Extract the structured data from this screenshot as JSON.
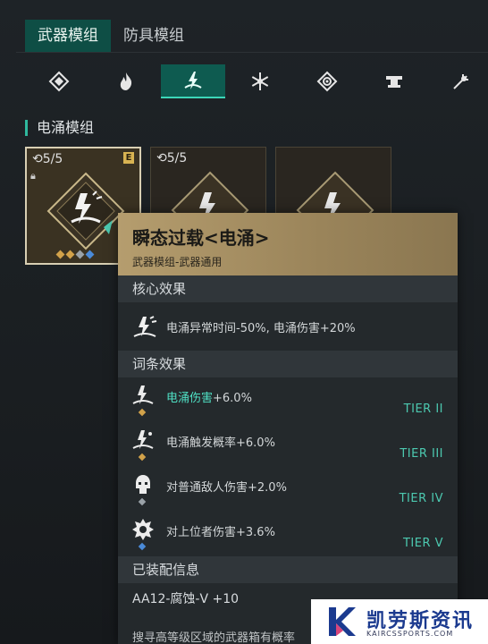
{
  "tabs": [
    {
      "label": "武器模组",
      "active": true
    },
    {
      "label": "防具模组",
      "active": false
    }
  ],
  "categories": [
    {
      "icon": "diamond-icon"
    },
    {
      "icon": "flame-icon"
    },
    {
      "icon": "electric-icon",
      "active": true
    },
    {
      "icon": "snowflake-icon"
    },
    {
      "icon": "poison-icon"
    },
    {
      "icon": "anvil-icon"
    },
    {
      "icon": "burst-icon"
    }
  ],
  "section_title": "电涌模组",
  "cards": [
    {
      "count": "5/5",
      "rank": "E",
      "selected": true
    },
    {
      "count": "5/5",
      "selected": false
    },
    {
      "selected": false
    }
  ],
  "tooltip": {
    "title": "瞬态过载<电涌>",
    "subtitle": "武器模组-武器通用",
    "core_label": "核心效果",
    "core_text": "电涌异常时间-50%, 电涌伤害+20%",
    "entries_label": "词条效果",
    "entries": [
      {
        "highlight": "电涌伤害",
        "rest": "+6.0%",
        "tier": "TIER II",
        "color": "#d2a24a"
      },
      {
        "highlight": "",
        "rest": "电涌触发概率+6.0%",
        "tier": "TIER III",
        "color": "#d2a24a"
      },
      {
        "highlight": "",
        "rest": "对普通敌人伤害+2.0%",
        "tier": "TIER IV",
        "color": "#9aa2a8"
      },
      {
        "highlight": "",
        "rest": "对上位者伤害+3.6%",
        "tier": "TIER V",
        "color": "#4a8ad8"
      }
    ],
    "equipped_label": "已装配信息",
    "weapon": "AA12-腐蚀-V +10",
    "bottom_text": "搜寻高等级区域的武器箱有概率"
  },
  "watermark": {
    "name": "凯劳斯资讯",
    "url": "KAIRCSSPORTS.COM"
  },
  "colors": {
    "accent": "#2fb89d",
    "active_tab": "#0e4e45",
    "tooltip_gold": "#b59d6e",
    "tier_text": "#4cc9b0"
  }
}
